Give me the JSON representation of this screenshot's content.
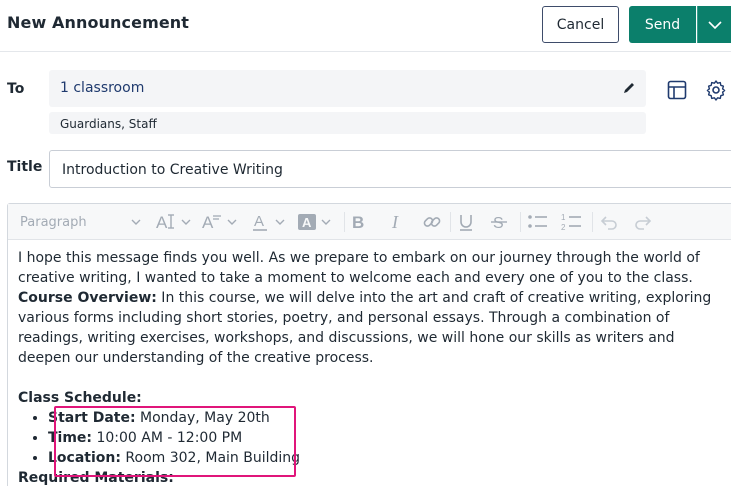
{
  "header": {
    "title": "New Announcement",
    "cancel_label": "Cancel",
    "send_label": "Send"
  },
  "recipients": {
    "label": "To",
    "value": "1 classroom",
    "sub_value": "Guardians, Staff"
  },
  "title_field": {
    "label": "Title",
    "value": "Introduction to Creative Writing"
  },
  "toolbar": {
    "paragraph_style": "Paragraph"
  },
  "body": {
    "intro": "I hope this message finds you well. As we prepare to embark on our journey through the world of creative writing, I wanted to take a moment to welcome each and every one of you to the class.",
    "overview_label": "Course Overview:",
    "overview_text": " In this course, we will delve into the art and craft of creative writing, exploring various forms including short stories, poetry, and personal essays. Through a combination of readings, writing exercises, workshops, and discussions, we will hone our skills as writers and deepen our understanding of the creative process.",
    "schedule_heading": "Class Schedule:",
    "schedule": [
      {
        "label": "Start Date:",
        "value": " Monday, May 20th"
      },
      {
        "label": "Time:",
        "value": " 10:00 AM - 12:00 PM"
      },
      {
        "label": "Location:",
        "value": " Room 302, Main Building"
      }
    ],
    "next_heading": "Required Materials:"
  },
  "colors": {
    "accent": "#0b7f6b",
    "highlight": "#e0157a"
  }
}
